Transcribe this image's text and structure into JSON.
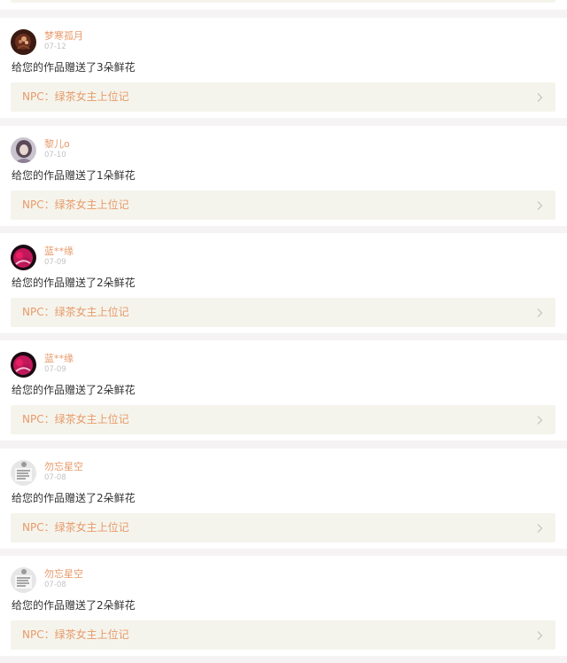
{
  "colors": {
    "accent": "#e79a6a",
    "link_bg": "#f5f4ec",
    "page_bg": "#f5f3f3",
    "text": "#333333",
    "muted": "#c2c2c2"
  },
  "feed": [
    {
      "username": "梦寒孤月",
      "date": "07-12",
      "message": "给您的作品赠送了3朵鲜花",
      "work_title": "NPC：绿茶女主上位记",
      "avatar": "dark-floral-avatar"
    },
    {
      "username": "黎儿o",
      "date": "07-10",
      "message": "给您的作品赠送了1朵鲜花",
      "work_title": "NPC：绿茶女主上位记",
      "avatar": "girl-portrait-avatar"
    },
    {
      "username": "蓝**缘",
      "date": "07-09",
      "message": "给您的作品赠送了2朵鲜花",
      "work_title": "NPC：绿茶女主上位记",
      "avatar": "pink-figure-avatar"
    },
    {
      "username": "蓝**缘",
      "date": "07-09",
      "message": "给您的作品赠送了2朵鲜花",
      "work_title": "NPC：绿茶女主上位记",
      "avatar": "pink-figure-avatar"
    },
    {
      "username": "勿忘星空",
      "date": "07-08",
      "message": "给您的作品赠送了2朵鲜花",
      "work_title": "NPC：绿茶女主上位记",
      "avatar": "text-note-avatar"
    },
    {
      "username": "勿忘星空",
      "date": "07-08",
      "message": "给您的作品赠送了2朵鲜花",
      "work_title": "NPC：绿茶女主上位记",
      "avatar": "text-note-avatar"
    }
  ],
  "icons": {
    "chevron": "chevron-right-icon"
  }
}
